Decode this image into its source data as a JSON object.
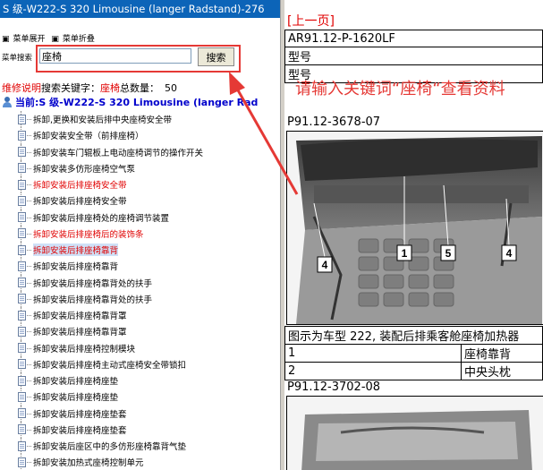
{
  "left": {
    "title": "S 级-W222-S 320 Limousine (langer Radstand)-276",
    "menu": {
      "expand": "菜单展开",
      "collapse": "菜单折叠"
    },
    "search": {
      "label": "菜单搜索",
      "value": "座椅",
      "button": "搜索"
    },
    "info": {
      "prefix": "维修说明",
      "keyword_label": "搜索关键字：",
      "keyword": "座椅",
      "count_label": "总数量：",
      "count": "50"
    },
    "current": "当前:S 级-W222-S 320 Limousine (langer Rad",
    "items": [
      {
        "label": "拆卸,更换和安装后排中央座椅安全带",
        "red": false
      },
      {
        "label": "拆卸安装安全带（前排座椅）",
        "red": false
      },
      {
        "label": "拆卸安装车门辊板上电动座椅调节的操作开关",
        "red": false
      },
      {
        "label": "拆卸安装多仿形座椅空气泵",
        "red": false
      },
      {
        "label": "拆卸安装后排座椅安全带",
        "red": true
      },
      {
        "label": "拆卸安装后排座椅安全带",
        "red": false
      },
      {
        "label": "拆卸安装后排座椅处的座椅调节装置",
        "red": false
      },
      {
        "label": "拆卸安装后排座椅后的装饰条",
        "red": true
      },
      {
        "label": "拆卸安装后排座椅靠背",
        "red": true,
        "selected": true
      },
      {
        "label": "拆卸安装后排座椅靠背",
        "red": false
      },
      {
        "label": "拆卸安装后排座椅靠背处的扶手",
        "red": false
      },
      {
        "label": "拆卸安装后排座椅靠背处的扶手",
        "red": false
      },
      {
        "label": "拆卸安装后排座椅靠背罩",
        "red": false
      },
      {
        "label": "拆卸安装后排座椅靠背罩",
        "red": false
      },
      {
        "label": "拆卸安装后排座椅控制模块",
        "red": false
      },
      {
        "label": "拆卸安装后排座椅主动式座椅安全带锁扣",
        "red": false
      },
      {
        "label": "拆卸安装后排座椅座垫",
        "red": false
      },
      {
        "label": "拆卸安装后排座椅座垫",
        "red": false
      },
      {
        "label": "拆卸安装后排座椅座垫套",
        "red": false
      },
      {
        "label": "拆卸安装后排座椅座垫套",
        "red": false
      },
      {
        "label": "拆卸安装后座区中的多仿形座椅靠背气垫",
        "red": false
      },
      {
        "label": "拆卸安装加热式座椅控制单元",
        "red": false
      }
    ]
  },
  "right": {
    "prev_link": "[上一页]",
    "doc_code": "AR91.12-P-1620LF",
    "row2": "型号",
    "row3": "型号",
    "hint": "请输入关键词“座椅“查看资料",
    "fig1_code": "P91.12-3678-07",
    "fig1_callouts": [
      "4",
      "1",
      "5",
      "4"
    ],
    "caption": "图示为车型 222, 装配后排乘客舱座椅加热器",
    "legend": [
      {
        "num": "1",
        "text": "座椅靠背"
      },
      {
        "num": "2",
        "text": "中央头枕"
      }
    ],
    "fig2_code": "P91.12-3702-08"
  },
  "colors": {
    "title_bg": "#0c64b8",
    "annotation_red": "#e53935",
    "link_red": "#e00000",
    "current_blue": "#0000cc"
  }
}
